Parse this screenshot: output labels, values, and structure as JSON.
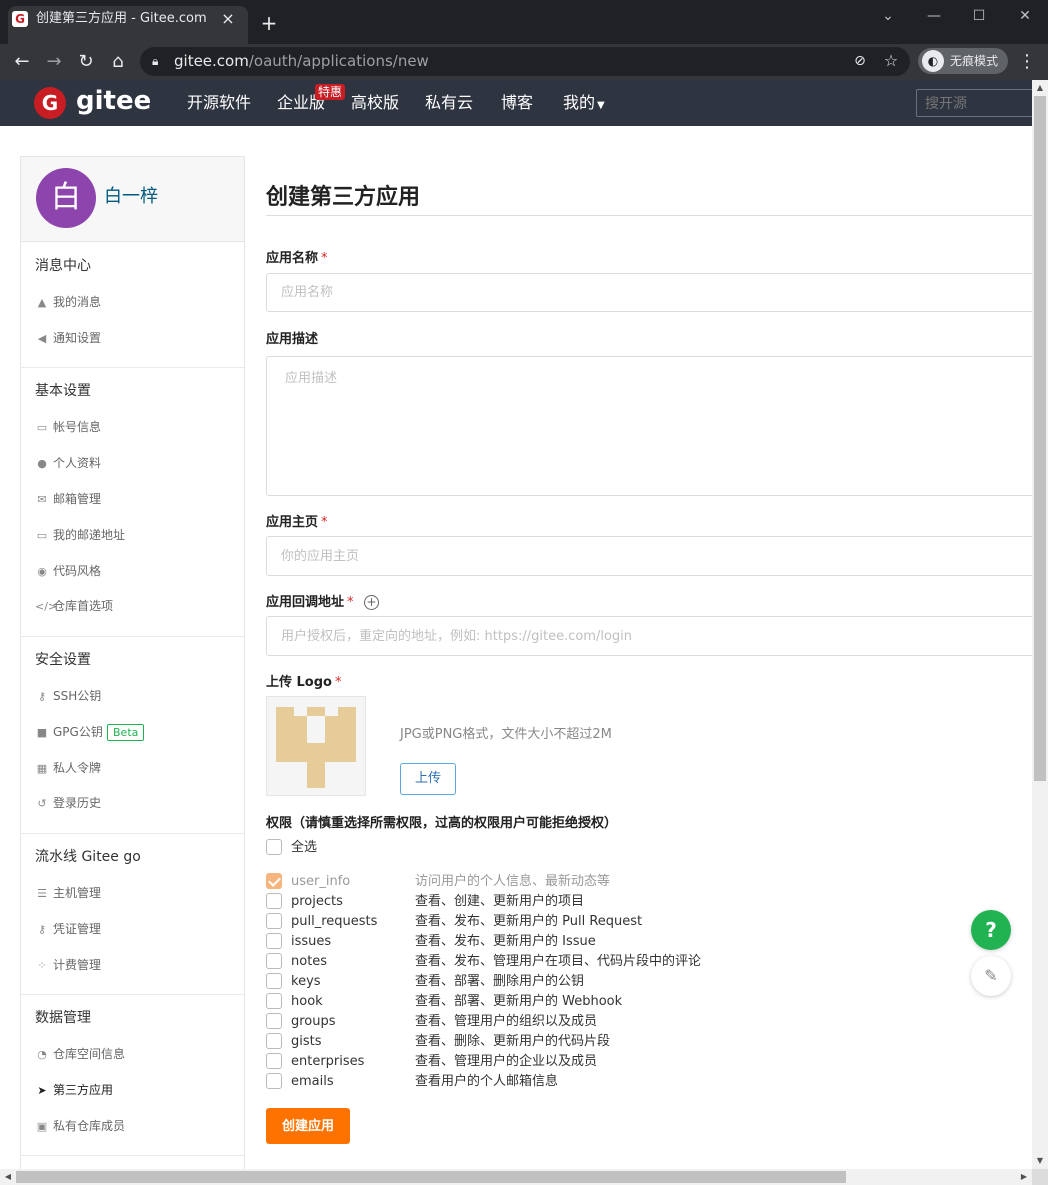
{
  "browser": {
    "tab_title": "创建第三方应用 - Gitee.com",
    "favicon_letter": "G",
    "url_host": "gitee.com",
    "url_path": "/oauth/applications/new",
    "incognito_label": "无痕模式"
  },
  "nav": {
    "logo_letter": "G",
    "logo_text": "gitee",
    "items": [
      "开源软件",
      "企业版",
      "高校版",
      "私有云",
      "博客",
      "我的"
    ],
    "badge": "特惠",
    "search_placeholder": "搜开源"
  },
  "user": {
    "avatar_char": "白",
    "name": "白一梓",
    "avatar_color": "#8e44ad"
  },
  "sidebar": {
    "sections": [
      {
        "title": "消息中心",
        "items": [
          {
            "icon": "bell-icon",
            "label": "我的消息"
          },
          {
            "icon": "speaker-icon",
            "label": "通知设置"
          }
        ]
      },
      {
        "title": "基本设置",
        "items": [
          {
            "icon": "id-card-icon",
            "label": "帐号信息"
          },
          {
            "icon": "user-icon",
            "label": "个人资料"
          },
          {
            "icon": "envelope-icon",
            "label": "邮箱管理"
          },
          {
            "icon": "address-card-icon",
            "label": "我的邮递地址"
          },
          {
            "icon": "palette-icon",
            "label": "代码风格"
          },
          {
            "icon": "code-icon",
            "label": "仓库首选项"
          }
        ]
      },
      {
        "title": "安全设置",
        "items": [
          {
            "icon": "key-icon",
            "label": "SSH公钥"
          },
          {
            "icon": "lock-icon",
            "label": "GPG公钥",
            "badge": "Beta"
          },
          {
            "icon": "token-icon",
            "label": "私人令牌"
          },
          {
            "icon": "history-icon",
            "label": "登录历史"
          }
        ]
      },
      {
        "title": "流水线 Gitee go",
        "items": [
          {
            "icon": "server-icon",
            "label": "主机管理"
          },
          {
            "icon": "key-icon",
            "label": "凭证管理"
          },
          {
            "icon": "billing-icon",
            "label": "计费管理"
          }
        ]
      },
      {
        "title": "数据管理",
        "items": [
          {
            "icon": "pie-chart-icon",
            "label": "仓库空间信息"
          },
          {
            "icon": "rocket-icon",
            "label": "第三方应用",
            "active": true
          },
          {
            "icon": "members-icon",
            "label": "私有仓库成员"
          }
        ]
      }
    ]
  },
  "form": {
    "title": "创建第三方应用",
    "name_label": "应用名称",
    "name_placeholder": "应用名称",
    "desc_label": "应用描述",
    "desc_placeholder": "应用描述",
    "home_label": "应用主页",
    "home_placeholder": "你的应用主页",
    "callback_label": "应用回调地址",
    "callback_placeholder": "用户授权后，重定向的地址，例如: https://gitee.com/login",
    "required_mark": "*",
    "logo_label": "上传 Logo",
    "logo_hint": "JPG或PNG格式，文件大小不超过2M",
    "upload_label": "上传",
    "perm_title": "权限（请慎重选择所需权限，过高的权限用户可能拒绝授权）",
    "select_all": "全选",
    "permissions": [
      {
        "name": "user_info",
        "desc": "访问用户的个人信息、最新动态等",
        "checked": true,
        "disabled": true
      },
      {
        "name": "projects",
        "desc": "查看、创建、更新用户的项目",
        "checked": false
      },
      {
        "name": "pull_requests",
        "desc": "查看、发布、更新用户的 Pull Request",
        "checked": false
      },
      {
        "name": "issues",
        "desc": "查看、发布、更新用户的 Issue",
        "checked": false
      },
      {
        "name": "notes",
        "desc": "查看、发布、管理用户在项目、代码片段中的评论",
        "checked": false
      },
      {
        "name": "keys",
        "desc": "查看、部署、删除用户的公钥",
        "checked": false
      },
      {
        "name": "hook",
        "desc": "查看、部署、更新用户的 Webhook",
        "checked": false
      },
      {
        "name": "groups",
        "desc": "查看、管理用户的组织以及成员",
        "checked": false
      },
      {
        "name": "gists",
        "desc": "查看、删除、更新用户的代码片段",
        "checked": false
      },
      {
        "name": "enterprises",
        "desc": "查看、管理用户的企业以及成员",
        "checked": false
      },
      {
        "name": "emails",
        "desc": "查看用户的个人邮箱信息",
        "checked": false
      }
    ],
    "submit_label": "创建应用"
  },
  "fab": {
    "help": "?"
  },
  "colors": {
    "brand_red": "#c71d23",
    "submit_orange": "#fe7300",
    "nav_bg": "#2e3440",
    "help_green": "#21b351"
  }
}
